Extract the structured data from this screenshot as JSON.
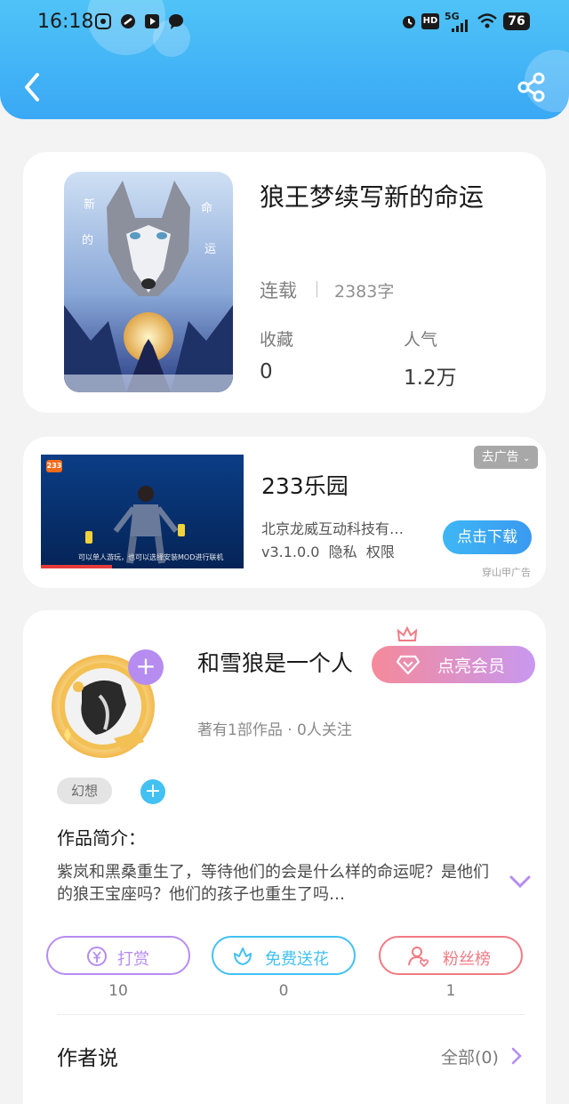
{
  "status_bar": {
    "time": "16:18",
    "battery": "76",
    "network": "5G",
    "hd": "HD"
  },
  "header": {
    "back_icon": "chevron-left-icon",
    "share_icon": "share-icon",
    "bg_color": "#3aa8f5"
  },
  "book": {
    "cover_chars": [
      "新",
      "的",
      "命",
      "运"
    ],
    "title": "狼王梦续写新的命运",
    "status": "连载",
    "word_count": "2383字",
    "favorites_label": "收藏",
    "favorites_value": "0",
    "popularity_label": "人气",
    "popularity_value": "1.2万"
  },
  "ad": {
    "remove_label": "去广告",
    "title": "233乐园",
    "company": "北京龙威互动科技有…",
    "version": "v3.1.0.0",
    "privacy": "隐私",
    "permission": "权限",
    "download_label": "点击下载",
    "source": "穿山甲广告",
    "badge": "233",
    "caption": "可以单人游玩，也可以选择安装MOD进行联机"
  },
  "author": {
    "name": "和雪狼是一个人",
    "vip_label": "点亮会员",
    "meta": "著有1部作品 · 0人关注",
    "tag": "幻想",
    "intro_title": "作品简介：",
    "intro_text": "紫岚和黑桑重生了，等待他们的会是什么样的命运呢？是他们的狼王宝座吗？他们的孩子也重生了吗…",
    "actions": [
      {
        "label": "打赏",
        "count": "10",
        "icon": "yuan-coin-icon",
        "color": "#b68cf0"
      },
      {
        "label": "免费送花",
        "count": "0",
        "icon": "flower-icon",
        "color": "#42c1f2"
      },
      {
        "label": "粉丝榜",
        "count": "1",
        "icon": "fan-user-icon",
        "color": "#f07a84"
      }
    ],
    "says_title": "作者说",
    "says_all": "全部(0)"
  }
}
